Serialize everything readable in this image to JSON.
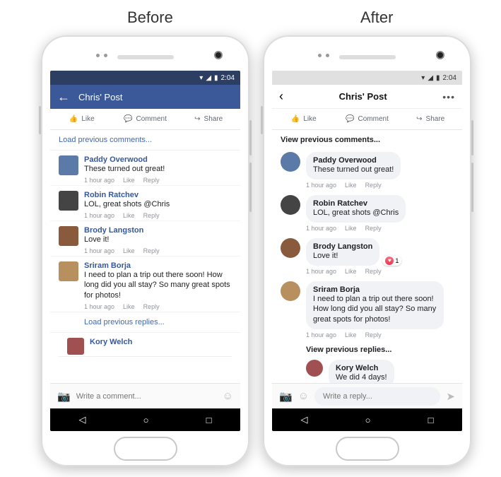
{
  "labels": {
    "before": "Before",
    "after": "After"
  },
  "status": {
    "time": "2:04"
  },
  "header": {
    "title": "Chris' Post"
  },
  "actions": {
    "like": "Like",
    "comment": "Comment",
    "share": "Share"
  },
  "before": {
    "loadPrev": "Load previous comments...",
    "loadReplies": "Load previous replies...",
    "comments": [
      {
        "name": "Paddy Overwood",
        "text": "These turned out great!",
        "time": "1 hour ago",
        "av": "#5b7aa8"
      },
      {
        "name": "Robin Ratchev",
        "text": "LOL, great shots @Chris",
        "time": "1 hour ago",
        "av": "#444"
      },
      {
        "name": "Brody Langston",
        "text": "Love it!",
        "time": "1 hour ago",
        "av": "#8a5a3c"
      },
      {
        "name": "Sriram Borja",
        "text": "I need to plan a trip out there soon! How long did you all stay? So many great spots for photos!",
        "time": "1 hour ago",
        "av": "#b89060"
      }
    ],
    "partialName": "Kory Welch",
    "composerPlaceholder": "Write a comment..."
  },
  "after": {
    "viewPrev": "View previous comments...",
    "viewReplies": "View previous replies...",
    "comments": [
      {
        "name": "Paddy Overwood",
        "text": "These turned out great!",
        "time": "1 hour ago",
        "av": "#5b7aa8"
      },
      {
        "name": "Robin Ratchev",
        "text": "LOL, great shots @Chris",
        "time": "1 hour ago",
        "av": "#444"
      },
      {
        "name": "Brody Langston",
        "text": "Love it!",
        "time": "1 hour ago",
        "av": "#8a5a3c",
        "react": "1"
      },
      {
        "name": "Sriram Borja",
        "text": "I need to plan a trip out there soon! How long did you all stay? So many great spots for photos!",
        "time": "1 hour ago",
        "av": "#b89060"
      }
    ],
    "reply": {
      "name": "Kory Welch",
      "text": "We did 4 days!",
      "av": "#a05050"
    },
    "composerPlaceholder": "Write a reply...",
    "metaLike": "Like",
    "metaReply": "Reply"
  }
}
